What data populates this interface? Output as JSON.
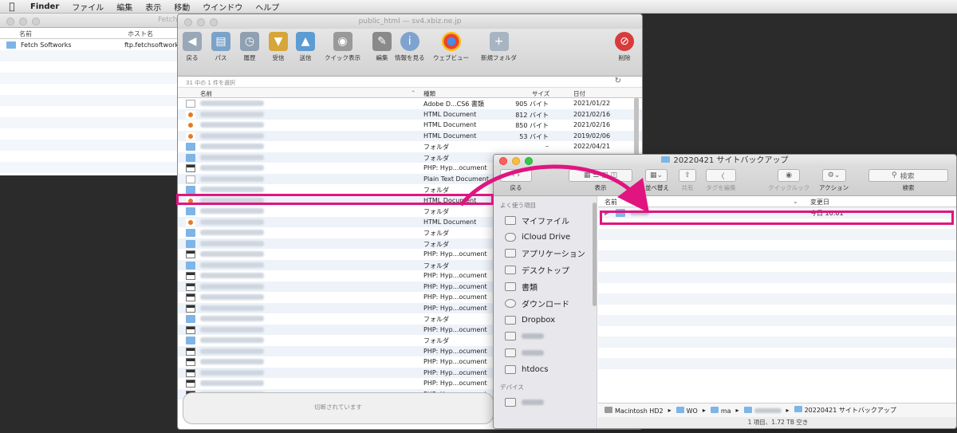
{
  "menubar": {
    "apple": "",
    "items": [
      "Finder",
      "ファイル",
      "編集",
      "表示",
      "移動",
      "ウインドウ",
      "ヘルプ"
    ]
  },
  "win1": {
    "title": "Fetch",
    "col_name": "名前",
    "col_host": "ホスト名",
    "rows": [
      {
        "name": "Fetch Softworks",
        "host": "ftp.fetchsoftworks"
      }
    ]
  },
  "fetch": {
    "title": "public_html — sv4.xbiz.ne.jp",
    "toolbar": [
      "戻る",
      "パス",
      "履歴",
      "受信",
      "送信",
      "クイック表示",
      "編集",
      "情報を見る",
      "ウェブビュー",
      "新規フォルダ",
      "削除"
    ],
    "status": "31 中の 1 件を選択",
    "columns": {
      "name": "名前",
      "kind": "種類",
      "size": "サイズ",
      "date": "日付"
    },
    "files": [
      {
        "icon": "doc",
        "kind": "Adobe D...CS6 書類",
        "size": "905 バイト",
        "date": "2021/01/22"
      },
      {
        "icon": "html",
        "kind": "HTML Document",
        "size": "812 バイト",
        "date": "2021/02/16"
      },
      {
        "icon": "html",
        "kind": "HTML Document",
        "size": "850 バイト",
        "date": "2021/02/16"
      },
      {
        "icon": "html",
        "kind": "HTML Document",
        "size": "53 バイト",
        "date": "2019/02/06"
      },
      {
        "icon": "folder",
        "kind": "フォルダ",
        "size": "–",
        "date": "2022/04/21"
      },
      {
        "icon": "folder",
        "kind": "フォルダ",
        "size": "–",
        "date": "2021/02/16"
      },
      {
        "icon": "php",
        "kind": "PHP: Hyp...ocument",
        "size": "",
        "date": ""
      },
      {
        "icon": "doc",
        "kind": "Plain Text Document",
        "size": "",
        "date": ""
      },
      {
        "icon": "folder",
        "kind": "フォルダ",
        "size": "",
        "date": ""
      },
      {
        "icon": "html",
        "kind": "HTML Document",
        "size": "",
        "date": ""
      },
      {
        "icon": "folder",
        "kind": "フォルダ",
        "size": "",
        "date": ""
      },
      {
        "icon": "html",
        "kind": "HTML Document",
        "size": "",
        "date": ""
      },
      {
        "icon": "folder",
        "kind": "フォルダ",
        "size": "",
        "date": ""
      },
      {
        "icon": "folder",
        "kind": "フォルダ",
        "size": "",
        "date": ""
      },
      {
        "icon": "php",
        "kind": "PHP: Hyp...ocument",
        "size": "",
        "date": ""
      },
      {
        "icon": "folder",
        "kind": "フォルダ",
        "size": "",
        "date": ""
      },
      {
        "icon": "php",
        "kind": "PHP: Hyp...ocument",
        "size": "",
        "date": ""
      },
      {
        "icon": "php",
        "kind": "PHP: Hyp...ocument",
        "size": "",
        "date": ""
      },
      {
        "icon": "php",
        "kind": "PHP: Hyp...ocument",
        "size": "",
        "date": ""
      },
      {
        "icon": "php",
        "kind": "PHP: Hyp...ocument",
        "size": "",
        "date": ""
      },
      {
        "icon": "folder",
        "kind": "フォルダ",
        "size": "",
        "date": ""
      },
      {
        "icon": "php",
        "kind": "PHP: Hyp...ocument",
        "size": "",
        "date": ""
      },
      {
        "icon": "folder",
        "kind": "フォルダ",
        "size": "",
        "date": ""
      },
      {
        "icon": "php",
        "kind": "PHP: Hyp...ocument",
        "size": "",
        "date": ""
      },
      {
        "icon": "php",
        "kind": "PHP: Hyp...ocument",
        "size": "",
        "date": ""
      },
      {
        "icon": "php",
        "kind": "PHP: Hyp...ocument",
        "size": "",
        "date": ""
      },
      {
        "icon": "php",
        "kind": "PHP: Hyp...ocument",
        "size": "",
        "date": ""
      },
      {
        "icon": "php",
        "kind": "PHP: Hyp...ocument",
        "size": "",
        "date": ""
      }
    ],
    "bottom_status": "切断されています"
  },
  "finder": {
    "title": "20220421  サイトバックアップ",
    "toolbar": {
      "back": "戻る",
      "view": "表示",
      "arrange": "並べ替え",
      "share": "共有",
      "tags": "タグを編集",
      "quicklook": "クイックルック",
      "action": "アクション",
      "search_label": "検索",
      "search_placeholder": "検索"
    },
    "sidebar_fav": "よく使う項目",
    "sidebar_items": [
      "マイファイル",
      "iCloud Drive",
      "アプリケーション",
      "デスクトップ",
      "書類",
      "ダウンロード",
      "Dropbox",
      "",
      "",
      "htdocs"
    ],
    "sidebar_devices": "デバイス",
    "columns": {
      "name": "名前",
      "modified": "変更日"
    },
    "row_date": "今日 10:01",
    "path": [
      "Macintosh HD2",
      "WO",
      "ma",
      "",
      "20220421  サイトバックアップ"
    ],
    "footer": "1 項目、1.72 TB 空き"
  },
  "colors": {
    "highlight": "#e0157f"
  }
}
